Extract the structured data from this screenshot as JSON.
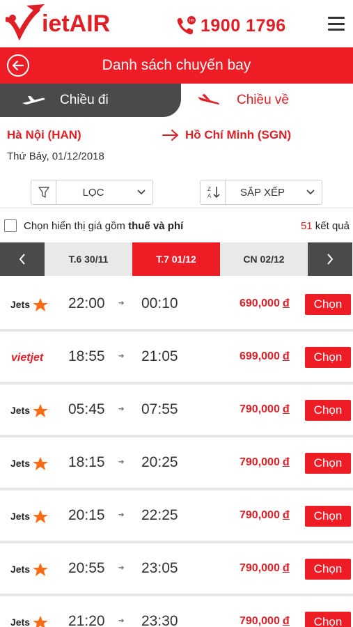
{
  "header": {
    "logo_v": "V",
    "logo_text": "ietAIR",
    "hotline": "1900 1796",
    "icons": {
      "phone": "phone-icon",
      "menu": "hamburger-menu-icon"
    }
  },
  "titlebar": {
    "title": "Danh sách chuyến bay"
  },
  "tabs": {
    "outbound": "Chiều đi",
    "return": "Chiều về"
  },
  "route": {
    "from": "Hà Nội (HAN)",
    "to": "Hồ Chí Minh (SGN)",
    "date": "Thứ Bảy, 01/12/2018"
  },
  "controls": {
    "filter_label": "LỌC",
    "sort_label": "SẮP XẾP"
  },
  "tax_option": {
    "label_prefix": "Chọn hiển thị giá gồm ",
    "label_bold": "thuế và phí",
    "checked": false,
    "result_count": "51",
    "result_suffix": " kết quả"
  },
  "date_strip": {
    "days": [
      {
        "label": "T.6 30/11",
        "active": false
      },
      {
        "label": "T.7 01/12",
        "active": true
      },
      {
        "label": "CN 02/12",
        "active": false
      }
    ]
  },
  "flights": [
    {
      "airline": "Jetstar",
      "dep": "22:00",
      "arr": "00:10",
      "price": "690,000",
      "currency": "đ",
      "button": "Chọn"
    },
    {
      "airline": "VietJet",
      "dep": "18:55",
      "arr": "21:05",
      "price": "699,000",
      "currency": "đ",
      "button": "Chọn"
    },
    {
      "airline": "Jetstar",
      "dep": "05:45",
      "arr": "07:55",
      "price": "790,000",
      "currency": "đ",
      "button": "Chọn"
    },
    {
      "airline": "Jetstar",
      "dep": "18:15",
      "arr": "20:25",
      "price": "790,000",
      "currency": "đ",
      "button": "Chọn"
    },
    {
      "airline": "Jetstar",
      "dep": "20:15",
      "arr": "22:25",
      "price": "790,000",
      "currency": "đ",
      "button": "Chọn"
    },
    {
      "airline": "Jetstar",
      "dep": "20:55",
      "arr": "23:05",
      "price": "790,000",
      "currency": "đ",
      "button": "Chọn"
    },
    {
      "airline": "Jetstar",
      "dep": "21:20",
      "arr": "23:30",
      "price": "790,000",
      "currency": "đ",
      "button": "Chọn"
    }
  ],
  "colors": {
    "brand_red": "#ee1c24",
    "dark_gray": "#4a4a4a",
    "light_gray": "#e9e9e9"
  }
}
